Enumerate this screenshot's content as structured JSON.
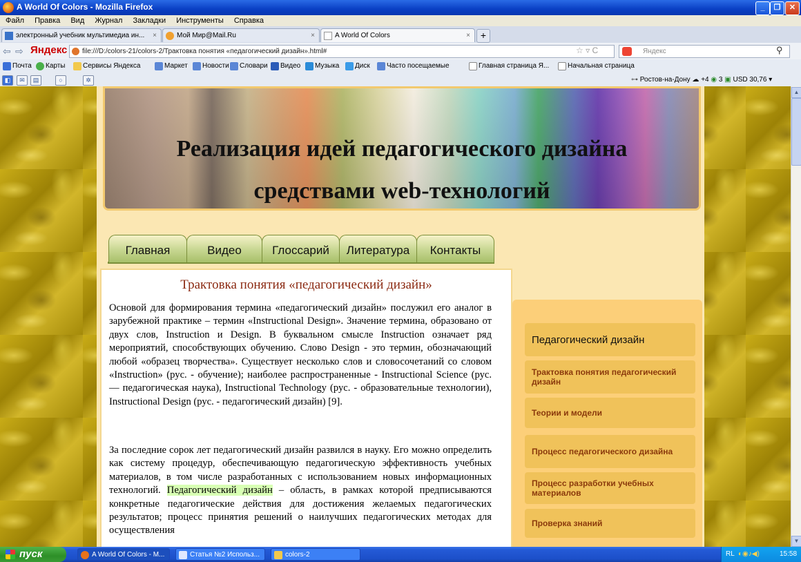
{
  "window": {
    "title": "A World Of Colors - Mozilla Firefox",
    "minimize": "_",
    "maximize": "❐",
    "close": "✕"
  },
  "menubar": [
    "Файл",
    "Правка",
    "Вид",
    "Журнал",
    "Закладки",
    "Инструменты",
    "Справка"
  ],
  "tabs": [
    {
      "label": "электронный учебник мультимедиа ин...",
      "close": "×"
    },
    {
      "label": "Мой Мир@Mail.Ru",
      "close": "×"
    },
    {
      "label": "A World Of Colors",
      "close": "×"
    }
  ],
  "new_tab": "+",
  "nav": {
    "back": "⇦",
    "forward": "⇨",
    "brand": "Яндекс",
    "url": "file:///D:/colors-21/colors-2/Трактовка понятия «педагогический дизайн».html#",
    "search_placeholder": "Яндекс"
  },
  "bookmarks": [
    "Почта",
    "Карты",
    "Сервисы Яндекса",
    "Маркет",
    "Новости",
    "Словари",
    "Видео",
    "Музыка",
    "Диск",
    "Часто посещаемые",
    "Главная страница Я...",
    "Начальная страница"
  ],
  "yandex_bar": {
    "weather": "Ростов-на-Дону",
    "temp": "+4",
    "mail_count": "3",
    "currency": "USD 30,76"
  },
  "site": {
    "title_line1": "Реализация идей педагогического дизайна",
    "title_line2": "средствами web-технологий",
    "menu": [
      "Главная",
      "Видео",
      "Глоссарий",
      "Литература",
      "Контакты"
    ],
    "article_title": "Трактовка понятия «педагогический дизайн»",
    "para1": "Основой для формирования термина «педагогический дизайн» послужил его аналог в зарубежной практике – термин «Instructional Design». Значение термина, образовано от двух слов, Instruction и Design. В буквальном смысле Instruction означает ряд мероприятий, способствующих обучению. Слово Design - это термин, обозначающий любой «образец творчества». Существует несколько слов и словосочетаний со словом «Instruction» (рус. - обучение); наиболее распространенные - Instructional Science (рус. — педагогическая наука), Instructional Technology (рус. - образовательные технологии), Instructional Design (рус. - педагогический дизайн) [9].",
    "para2_a": "За последние сорок лет педагогический дизайн развился в науку. Его можно определить как систему процедур, обеспечивающую педагогическую эффективность учебных материалов, в том числе разработанных с использованием новых информационных технологий.",
    "para2_highlight": "Педагогический дизайн",
    "para2_b": "– область, в рамках которой предписываются конкретные педагогические действия для достижения желаемых педагогических результатов; процесс принятия решений о наилучших педагогических методах для осуществления",
    "sidebar_title": "Педагогический дизайн",
    "sidebar_items": [
      "Трактовка понятия педагогический дизайн",
      "Теории и модели",
      "Процесс педагогического дизайна",
      "Процесс разработки учебных материалов",
      "Проверка знаний"
    ]
  },
  "taskbar": {
    "start": "пуск",
    "buttons": [
      "A World Of Colors - M...",
      "Статья №2 Использ...",
      "colors-2"
    ],
    "lang": "RL",
    "time": "15:58"
  },
  "colors": {
    "brand_red": "#cc0000",
    "article_title": "#8b2a12",
    "sidebar_link": "#8b3a0c",
    "highlight": "#d8ffb4"
  }
}
